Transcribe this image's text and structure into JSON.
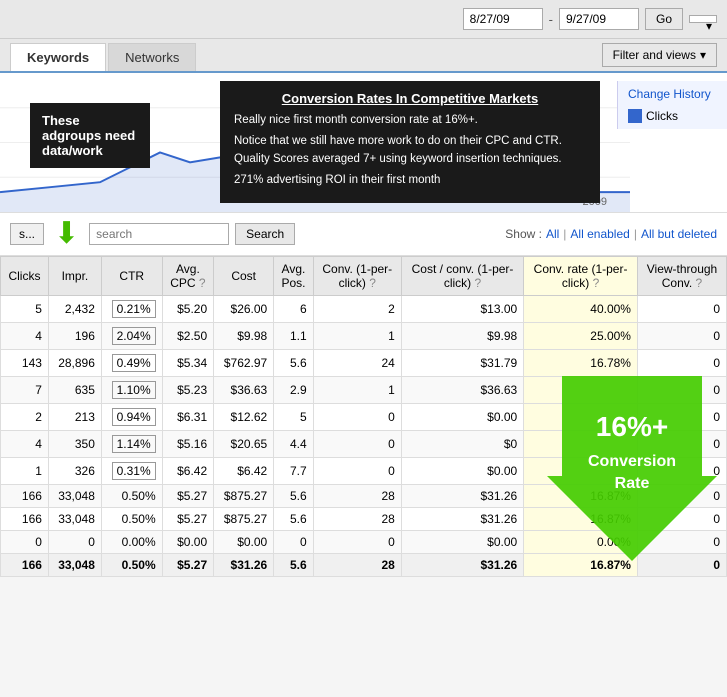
{
  "topbar": {
    "date_from": "8/27/09",
    "date_to": "9/27/09",
    "go_label": "Go",
    "dropdown_label": ""
  },
  "tabs": {
    "keywords_label": "Keywords",
    "networks_label": "Networks",
    "filter_label": "Filter and views"
  },
  "chart": {
    "adgroups_note": "These adgroups need data/work",
    "change_history_link": "Change History",
    "clicks_legend": "Clicks",
    "year_label": "2009",
    "annotation": {
      "title": "Conversion Rates In Competitive Markets",
      "line1": "Really nice first month conversion rate at 16%+.",
      "line2": "Notice that we still have more work to do on their CPC and CTR. Quality Scores averaged 7+ using keyword insertion techniques.",
      "line3": "271% advertising ROI in their first month"
    }
  },
  "search_bar": {
    "segment_label": "s...",
    "search_placeholder": "search",
    "search_btn_label": "Search",
    "show_label": "Show :",
    "all_label": "All",
    "all_enabled_label": "All enabled",
    "all_but_deleted_label": "All but deleted"
  },
  "table": {
    "headers": [
      "Clicks",
      "Impr.",
      "CTR",
      "Avg. CPC",
      "Cost",
      "Avg. Pos.",
      "Conv. (1-per-click)",
      "Cost / conv. (1-per-click)",
      "Conv. rate (1-per-click)",
      "View-through Conv."
    ],
    "rows": [
      [
        "5",
        "2,432",
        "0.21%",
        "$5.20",
        "$26.00",
        "6",
        "2",
        "$13.00",
        "40.00%",
        "0"
      ],
      [
        "4",
        "196",
        "2.04%",
        "$2.50",
        "$9.98",
        "1.1",
        "1",
        "$9.98",
        "25.00%",
        "0"
      ],
      [
        "143",
        "28,896",
        "0.49%",
        "$5.34",
        "$762.97",
        "5.6",
        "24",
        "$31.79",
        "16.78%",
        "0"
      ],
      [
        "7",
        "635",
        "1.10%",
        "$5.23",
        "$36.63",
        "2.9",
        "1",
        "$36.63",
        "",
        "0"
      ],
      [
        "2",
        "213",
        "0.94%",
        "$6.31",
        "$12.62",
        "5",
        "0",
        "$0.00",
        "",
        "0"
      ],
      [
        "4",
        "350",
        "1.14%",
        "$5.16",
        "$20.65",
        "4.4",
        "0",
        "$0",
        "",
        "0"
      ],
      [
        "1",
        "326",
        "0.31%",
        "$6.42",
        "$6.42",
        "7.7",
        "0",
        "$0.00",
        "",
        "0"
      ],
      [
        "166",
        "33,048",
        "0.50%",
        "$5.27",
        "$875.27",
        "5.6",
        "28",
        "$31.26",
        "16.87%",
        "0"
      ],
      [
        "166",
        "33,048",
        "0.50%",
        "$5.27",
        "$875.27",
        "5.6",
        "28",
        "$31.26",
        "16.87%",
        "0"
      ],
      [
        "0",
        "0",
        "0.00%",
        "$0.00",
        "$0.00",
        "0",
        "0",
        "$0.00",
        "0.00%",
        "0"
      ],
      [
        "166",
        "33,048",
        "0.50%",
        "$5.27",
        "$31.26",
        "5.6",
        "28",
        "$31.26",
        "16.87%",
        "0"
      ]
    ],
    "boxed_cells": [
      [
        0,
        2
      ],
      [
        1,
        2
      ],
      [
        2,
        2
      ],
      [
        3,
        2
      ],
      [
        4,
        2
      ],
      [
        5,
        2
      ],
      [
        6,
        2
      ]
    ],
    "conversion_arrow": {
      "label": "16%+",
      "sublabel": "Conversion Rate"
    }
  }
}
